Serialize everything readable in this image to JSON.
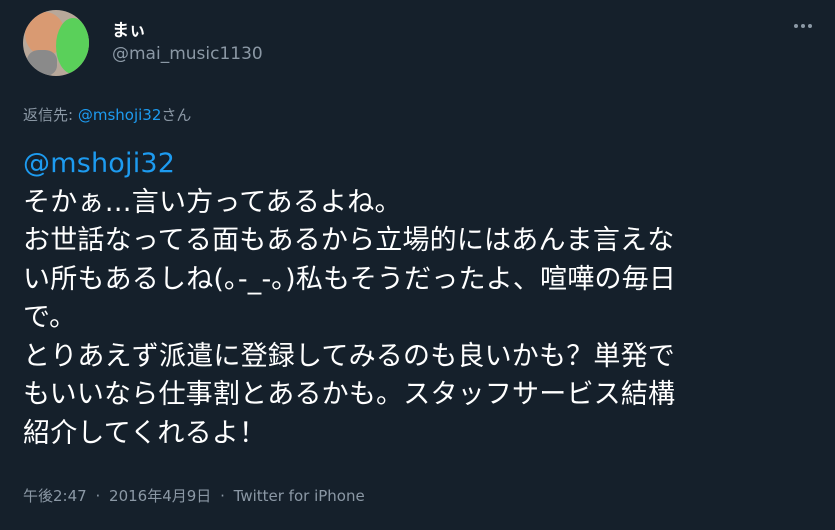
{
  "author": {
    "display_name": "まぃ",
    "handle": "@mai_music1130"
  },
  "reply": {
    "prefix": "返信先: ",
    "mention": "@mshoji32",
    "suffix": "さん"
  },
  "tweet": {
    "mention": "@mshoji32",
    "lines": [
      "そかぁ…言い方ってあるよね。",
      "お世話なってる面もあるから立場的にはあんま言えな",
      "い所もあるしね(｡-_-｡)私もそうだったよ、喧嘩の毎日",
      "で。",
      "とりあえず派遣に登録してみるのも良いかも？単発で",
      "もいいなら仕事割とあるかも。スタッフサービス結構",
      "紹介してくれるよ！"
    ]
  },
  "meta": {
    "time": "午後2:47",
    "separator": "·",
    "date": "2016年4月9日",
    "source": "Twitter for iPhone"
  },
  "icons": {
    "more": "more-options-icon",
    "avatar": "profile-avatar"
  },
  "colors": {
    "background": "#15202b",
    "link": "#1d9bf0",
    "secondary_text": "#8b98a5"
  }
}
